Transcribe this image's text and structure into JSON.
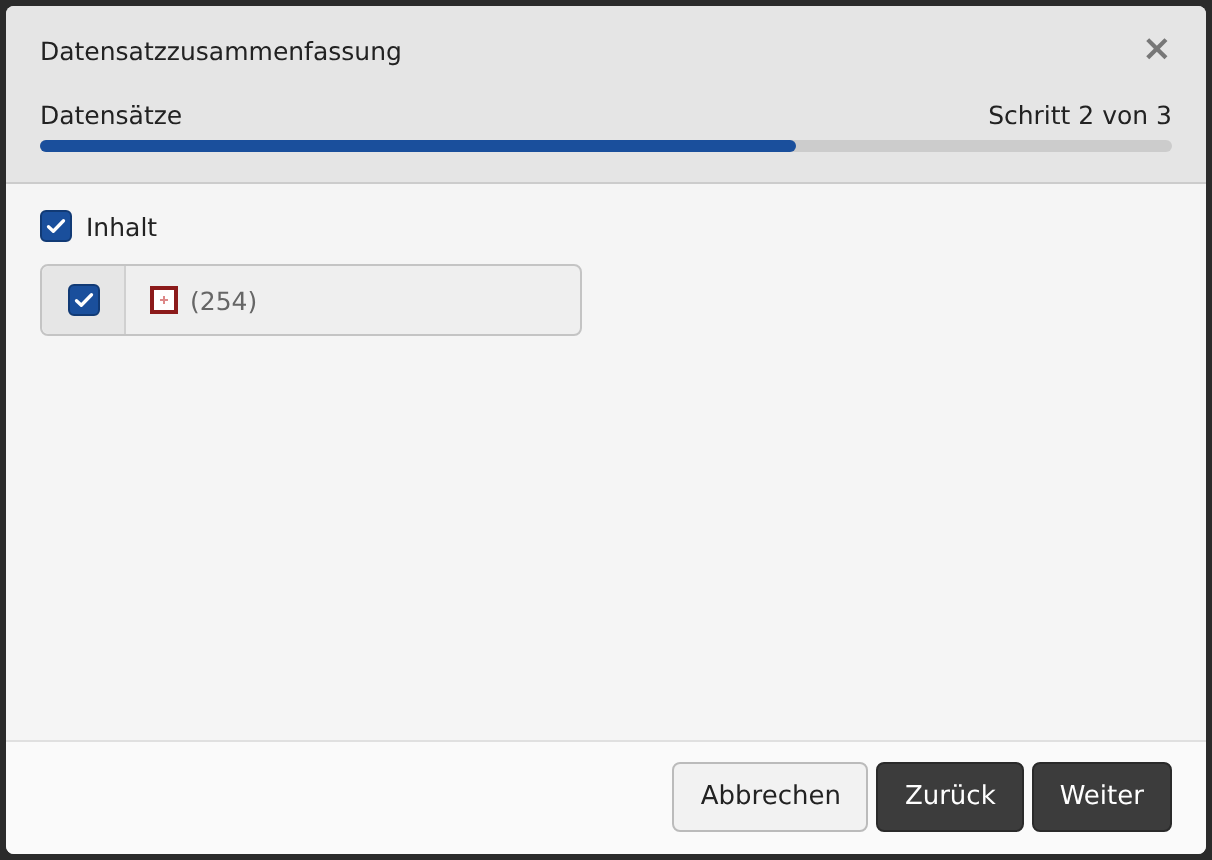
{
  "dialog": {
    "title": "Datensatzzusammenfassung",
    "close": "×"
  },
  "progress": {
    "label": "Datensätze",
    "step": "Schritt 2 von 3",
    "level": 0.667
  },
  "group": {
    "label": "Inhalt",
    "checked": true
  },
  "items": [
    {
      "checked": true,
      "text": "(254)"
    }
  ],
  "buttons": [
    {
      "label": "Abbrechen",
      "kind": "default"
    },
    {
      "label": "Zurück",
      "kind": "primary"
    },
    {
      "label": "Weiter",
      "kind": "primary"
    }
  ]
}
